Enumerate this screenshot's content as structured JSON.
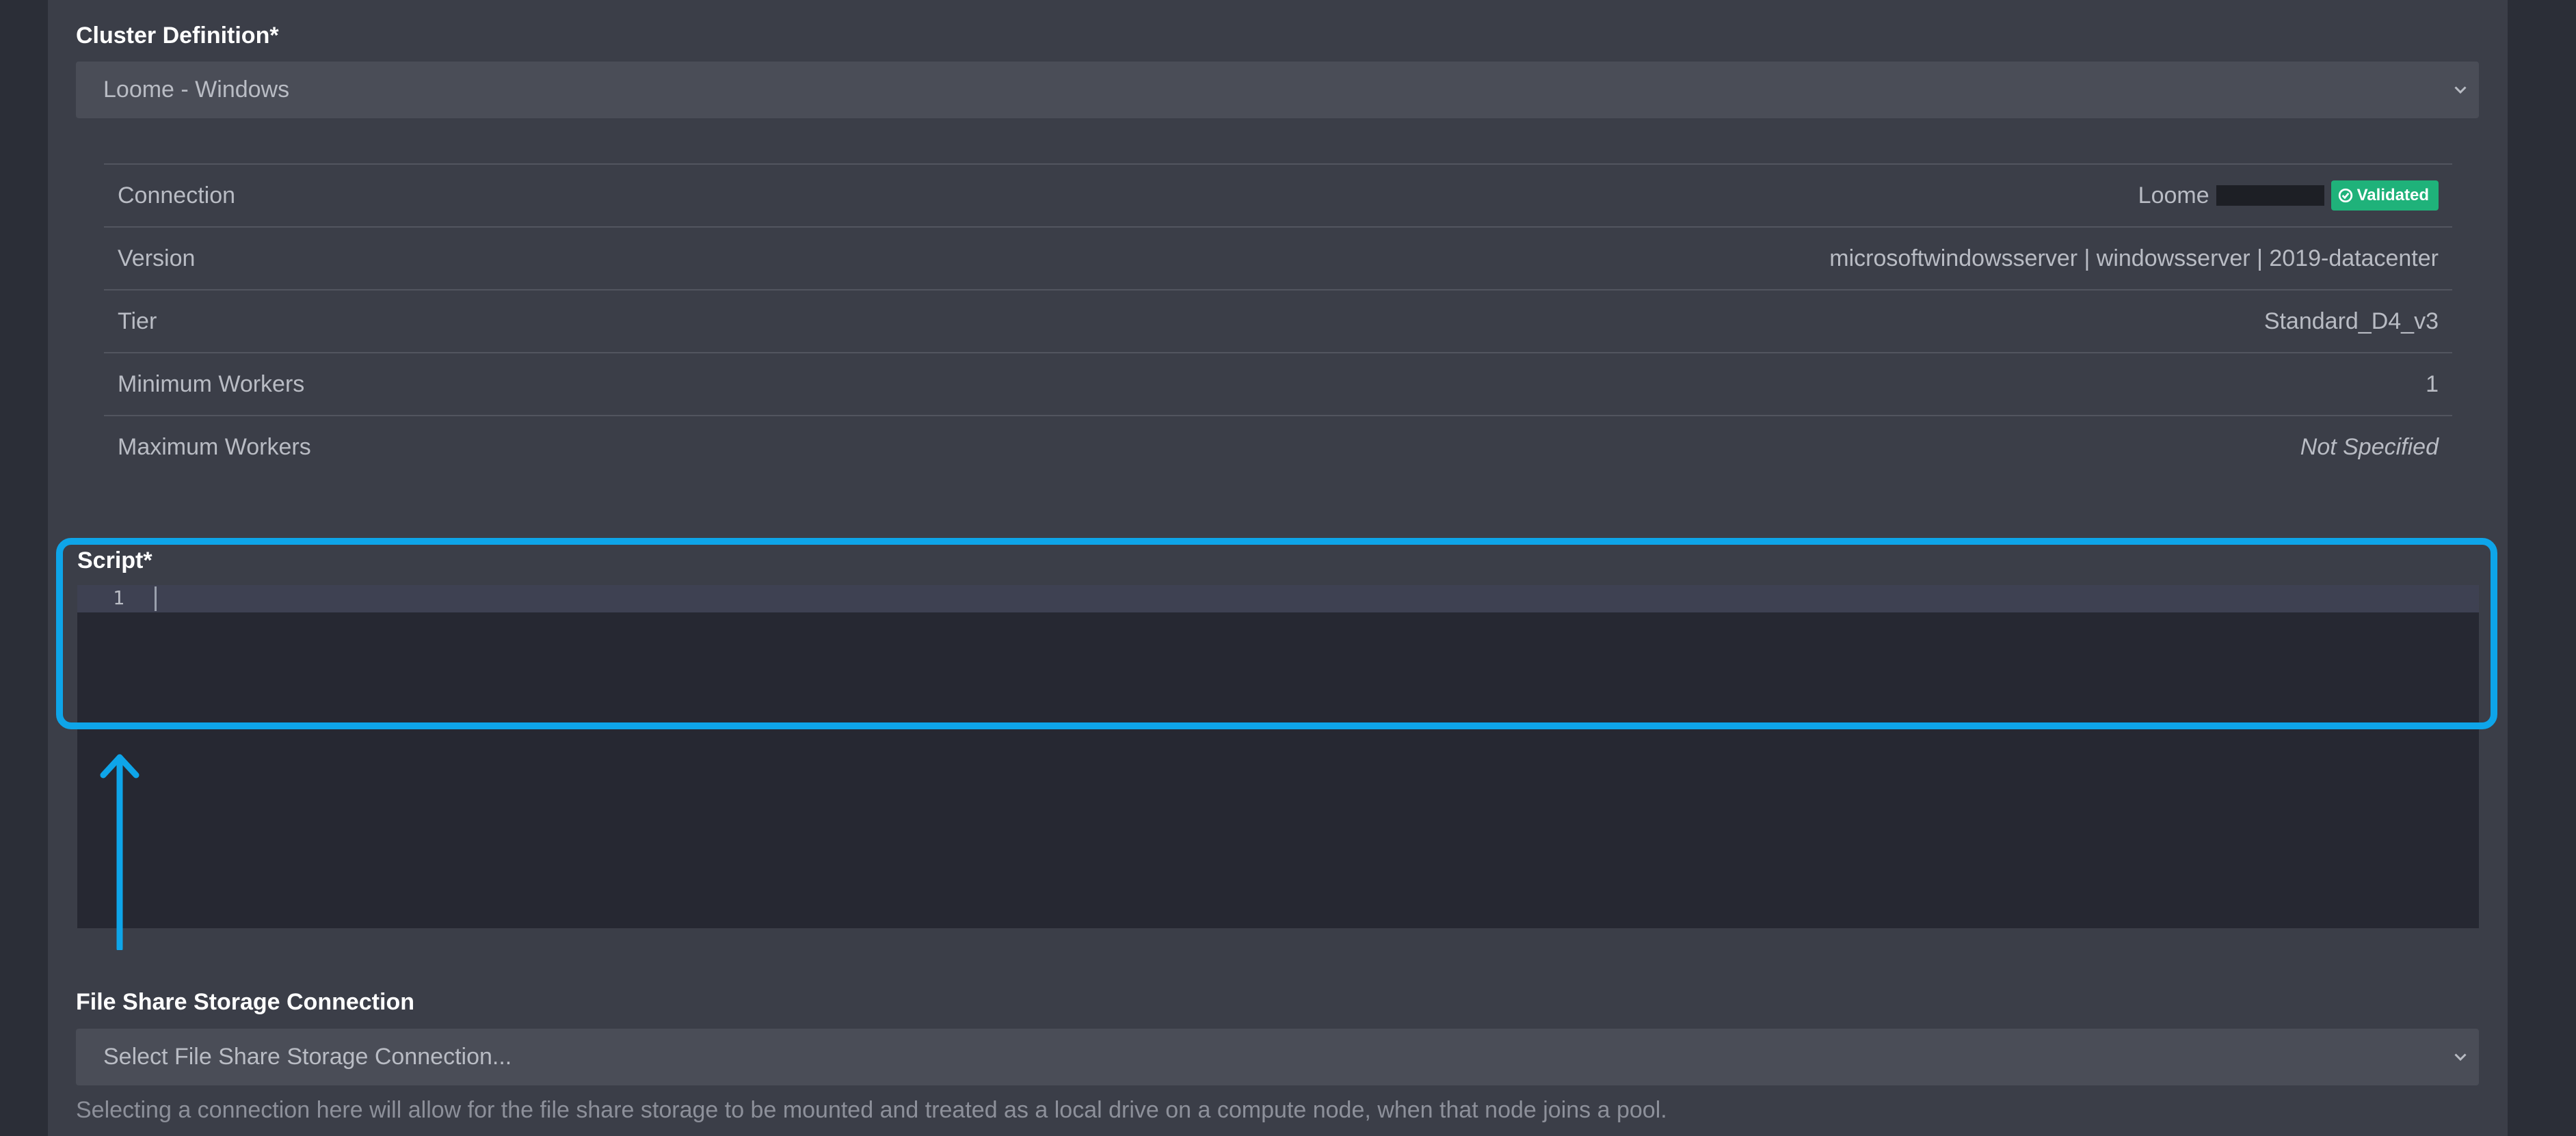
{
  "cluster": {
    "label": "Cluster Definition*",
    "selected": "Loome  - Windows"
  },
  "details": [
    {
      "name": "Connection",
      "value": "Loome",
      "badge": "Validated"
    },
    {
      "name": "Version",
      "value": "microsoftwindowsserver | windowsserver | 2019-datacenter"
    },
    {
      "name": "Tier",
      "value": "Standard_D4_v3"
    },
    {
      "name": "Minimum Workers",
      "value": "1"
    },
    {
      "name": "Maximum Workers",
      "value": "Not Specified"
    }
  ],
  "script": {
    "label": "Script*",
    "line_number": "1"
  },
  "file_share": {
    "label": "File Share Storage Connection",
    "placeholder": "Select File Share Storage Connection...",
    "help": "Selecting a connection here will allow for the file share storage to be mounted and treated as a local drive on a compute node, when that node joins a pool."
  },
  "icons": {
    "dropdown": "chevron-down-icon",
    "validated": "check-circle-icon",
    "annotation": "arrow-up-icon"
  },
  "colors": {
    "highlight": "#0ea5e9",
    "badge": "#1fb27a",
    "panel": "#3b3e48",
    "background": "#2b2e37"
  }
}
